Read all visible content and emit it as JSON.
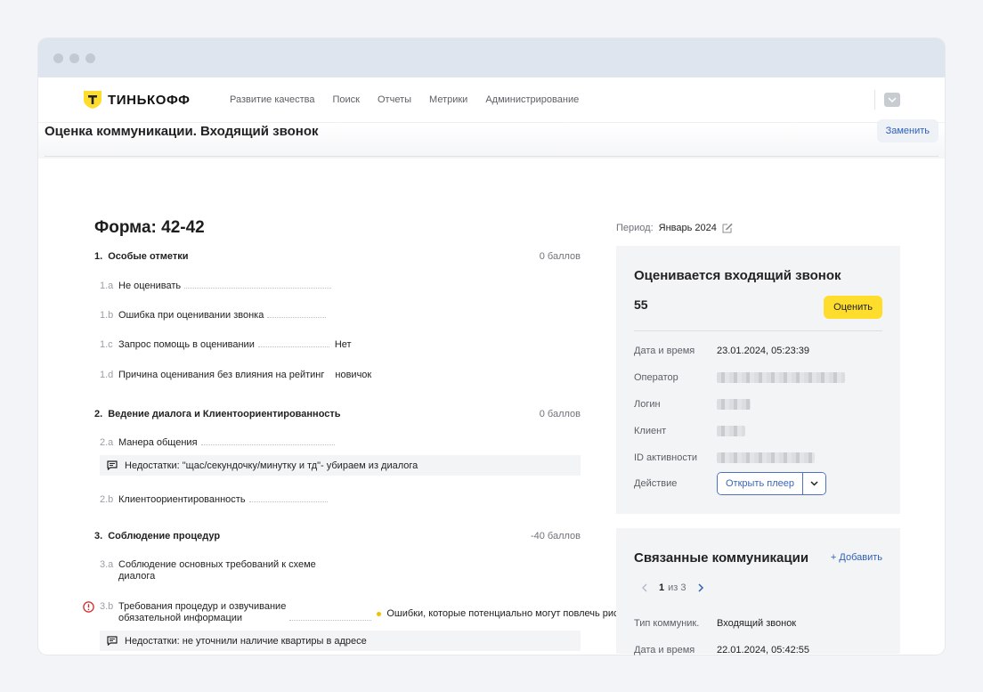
{
  "nav": {
    "brand": "ТИНЬКОФФ",
    "items": [
      "Развитие качества",
      "Поиск",
      "Отчеты",
      "Метрики",
      "Администрирование"
    ]
  },
  "page": {
    "title": "Оценка коммуникации. Входящий звонок",
    "replace_label": "Заменить"
  },
  "form": {
    "title": "Форма: 42-42",
    "sections": [
      {
        "num": "1.",
        "title": "Особые отметки",
        "score": "0 баллов",
        "items": [
          {
            "code": "1.a",
            "label": "Не оценивать",
            "value": ""
          },
          {
            "code": "1.b",
            "label": "Ошибка при оценивании звонка",
            "value": ""
          },
          {
            "code": "1.c",
            "label": "Запрос помощь в оценивании",
            "value": "Нет"
          },
          {
            "code": "1.d",
            "label": "Причина оценивания без влияния на рейтинг",
            "value": "новичок"
          }
        ]
      },
      {
        "num": "2.",
        "title": "Ведение диалога и Клиентоориентированность",
        "score": "0 баллов",
        "items": [
          {
            "code": "2.a",
            "label": "Манера общения",
            "value": "",
            "note": "Недостатки: \"щас/секундочку/минутку и тд\"- убираем из диалога"
          },
          {
            "code": "2.b",
            "label": "Клиентоориентированность",
            "value": ""
          }
        ]
      },
      {
        "num": "3.",
        "title": "Соблюдение процедур",
        "score": "-40 баллов",
        "items": [
          {
            "code": "3.a",
            "label_1": "Соблюдение основных требований к схеме",
            "label_2": "диалога",
            "value": ""
          },
          {
            "code": "3.b",
            "label_1": "Требования процедур и озвучивание",
            "label_2": "обязательной информации",
            "value": "Ошибки, которые потенциально могут повлечь риски",
            "note": "Недостатки: не уточнили наличие квартиры в адресе"
          }
        ]
      }
    ]
  },
  "period": {
    "label": "Период:",
    "value": "Январь 2024"
  },
  "evaluation": {
    "title": "Оценивается входящий звонок",
    "score": "55",
    "rate_label": "Оценить",
    "date_key": "Дата и время",
    "date_val": "23.01.2024, 05:23:39",
    "operator_key": "Оператор",
    "login_key": "Логин",
    "client_key": "Клиент",
    "activity_key": "ID активности",
    "action_key": "Действие",
    "player_label": "Открыть плеер"
  },
  "related": {
    "title": "Связанные коммуникации",
    "add_label": "+ Добавить",
    "page_current": "1",
    "page_of": "из 3",
    "type_key": "Тип коммуник.",
    "type_val": "Входящий звонок",
    "date_key": "Дата и время",
    "date_val": "22.01.2024, 05:42:55"
  },
  "colors": {
    "brand_yellow": "#ffdd2d",
    "link_blue": "#3060b8",
    "error_red": "#d42a2a",
    "warning_yellow": "#f2c000"
  }
}
